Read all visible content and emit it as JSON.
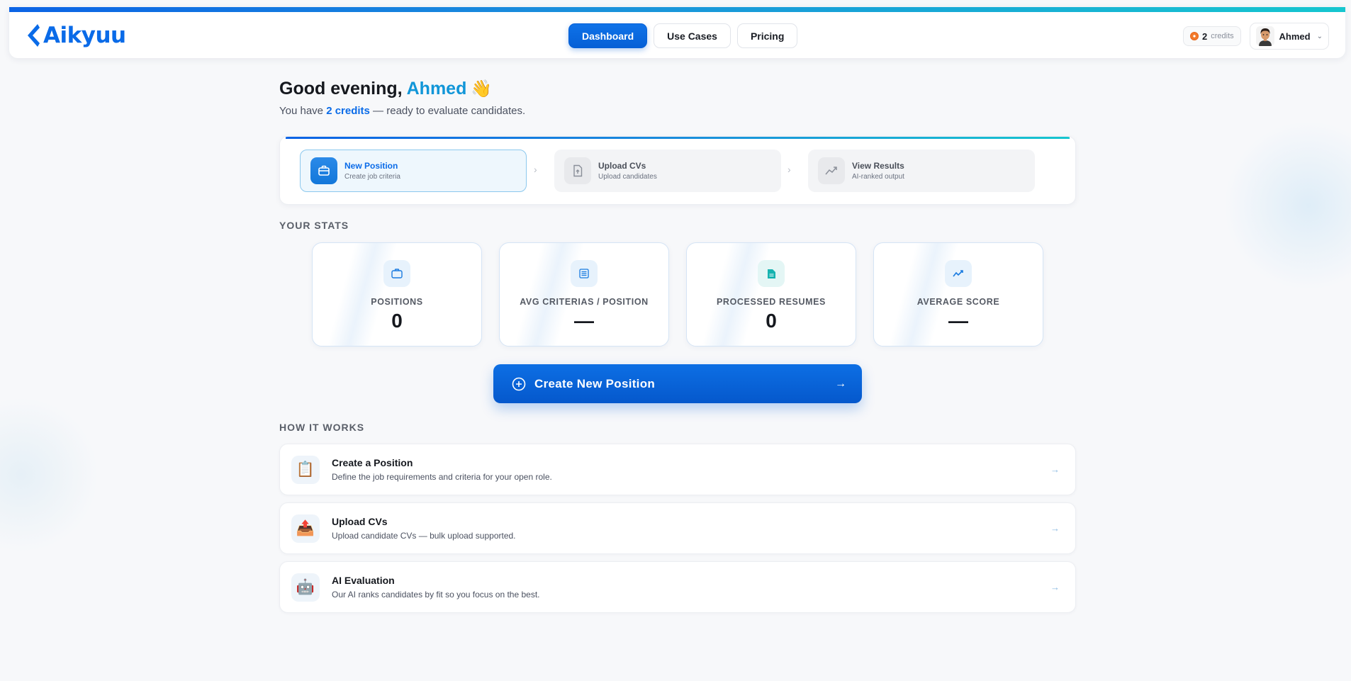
{
  "header": {
    "logo_text": "Aikyuu",
    "nav": [
      {
        "label": "Dashboard",
        "active": true
      },
      {
        "label": "Use Cases",
        "active": false
      },
      {
        "label": "Pricing",
        "active": false
      }
    ],
    "credits": {
      "count": "2",
      "label": "credits"
    },
    "user": {
      "name": "Ahmed"
    }
  },
  "greeting": {
    "prefix": "Good evening,",
    "name": "Ahmed",
    "emoji": "👋",
    "sub_before": "You have ",
    "sub_credits": "2 credits",
    "sub_after": " — ready to evaluate candidates."
  },
  "steps": [
    {
      "title": "New Position",
      "subtitle": "Create job criteria",
      "icon": "briefcase-icon",
      "active": true
    },
    {
      "title": "Upload CVs",
      "subtitle": "Upload candidates",
      "icon": "file-upload-icon",
      "active": false
    },
    {
      "title": "View Results",
      "subtitle": "AI-ranked output",
      "icon": "trend-icon",
      "active": false
    }
  ],
  "stats_title": "YOUR STATS",
  "stats": [
    {
      "label": "POSITIONS",
      "value": "0",
      "icon": "briefcase-icon"
    },
    {
      "label": "AVG CRITERIAS / POSITION",
      "value": "—",
      "icon": "list-icon"
    },
    {
      "label": "PROCESSED RESUMES",
      "value": "0",
      "icon": "document-icon"
    },
    {
      "label": "AVERAGE SCORE",
      "value": "—",
      "icon": "trend-icon"
    }
  ],
  "cta": {
    "label": "Create New Position"
  },
  "how_title": "HOW IT WORKS",
  "how_items": [
    {
      "emoji": "📋",
      "title": "Create a Position",
      "desc": "Define the job requirements and criteria for your open role."
    },
    {
      "emoji": "📤",
      "title": "Upload CVs",
      "desc": "Upload candidate CVs — bulk upload supported."
    },
    {
      "emoji": "🤖",
      "title": "AI Evaluation",
      "desc": "Our AI ranks candidates by fit so you focus on the best."
    }
  ],
  "colors": {
    "brand": "#0a6be8",
    "accent_teal": "#16c6cf",
    "name_highlight": "#1196d8"
  }
}
